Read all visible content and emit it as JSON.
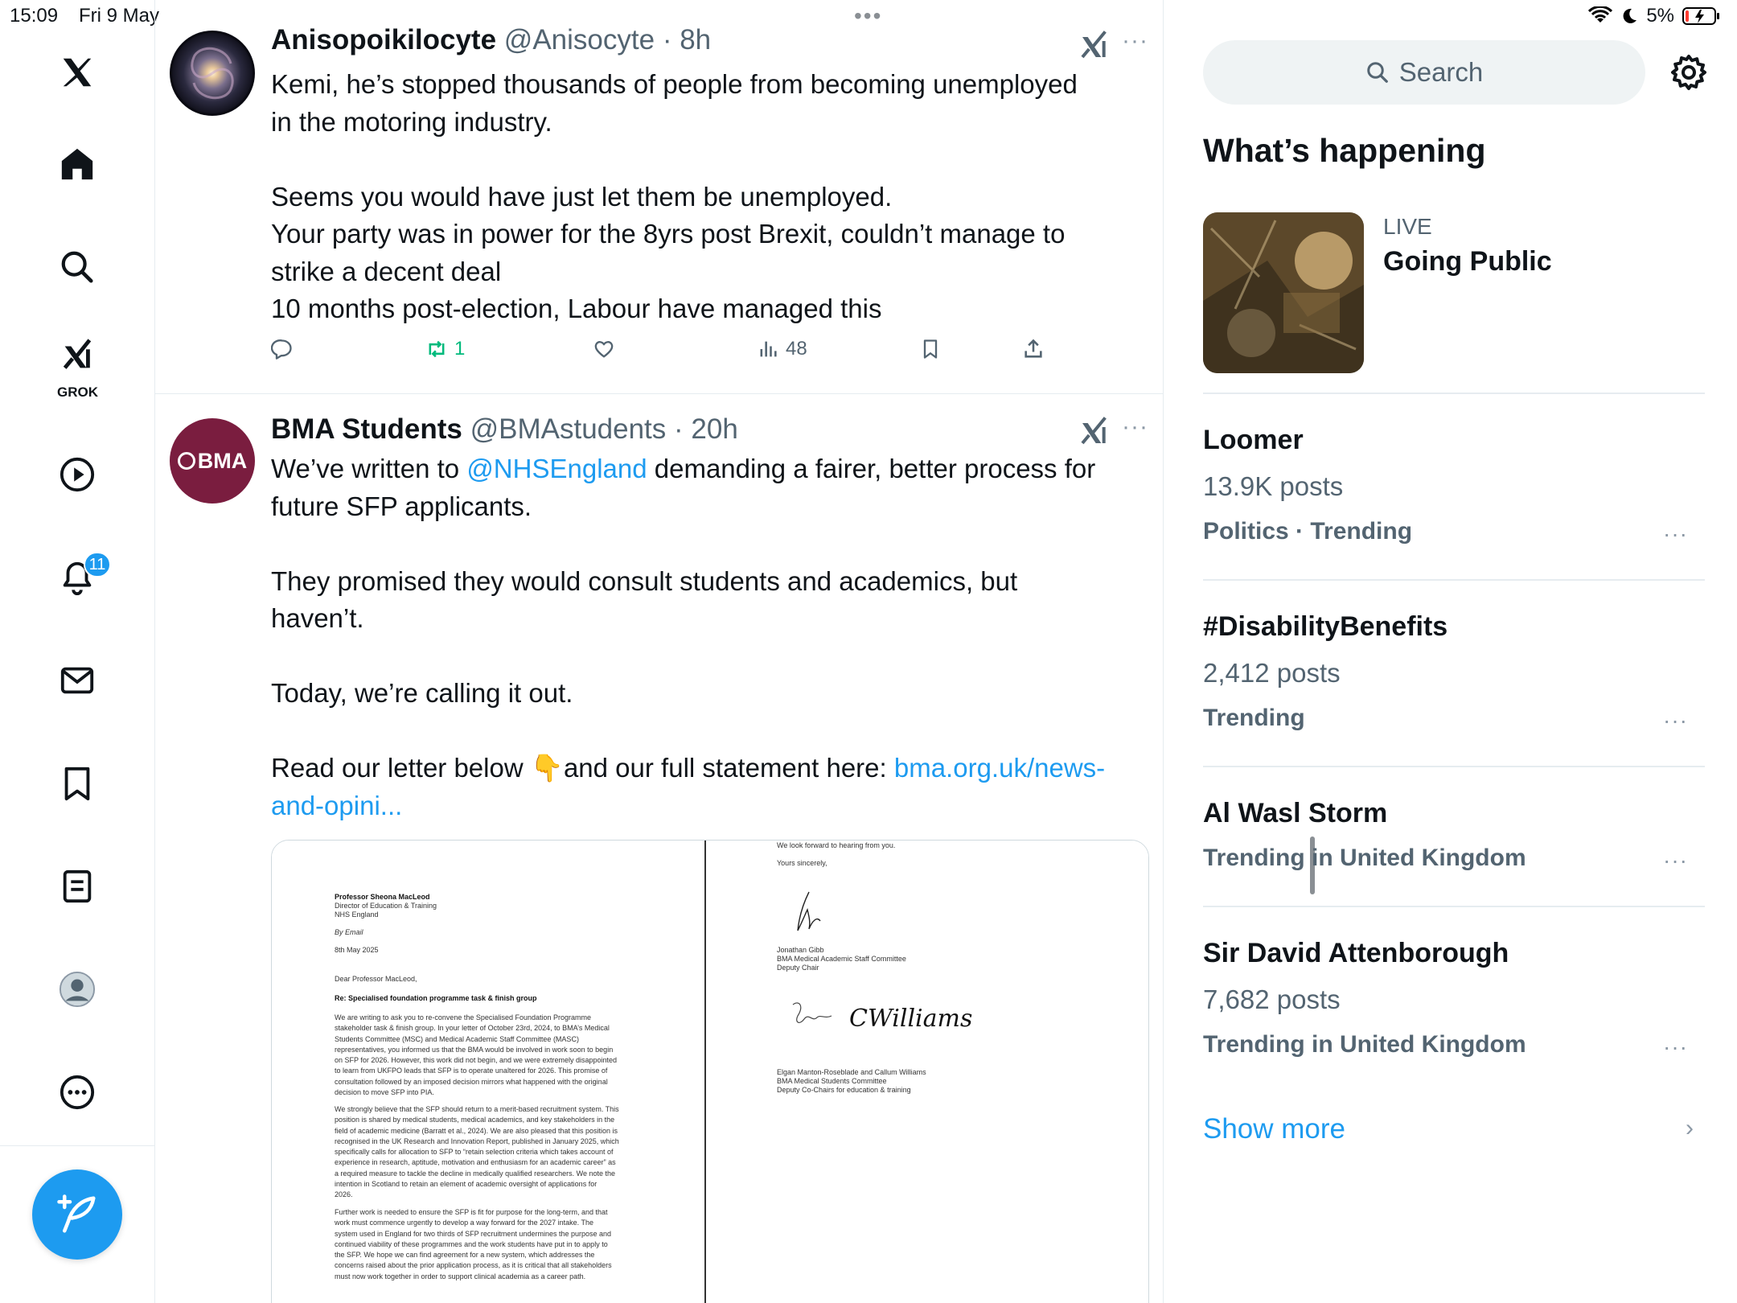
{
  "status_bar": {
    "time": "15:09",
    "date": "Fri 9 May",
    "battery": "5%",
    "multitask_dots": "•••"
  },
  "nav": {
    "grok_label": "GROK",
    "notifications_badge": "11"
  },
  "tweets": [
    {
      "name": "Anisopoikilocyte",
      "handle": "@Anisocyte",
      "sep": "·",
      "time": "8h",
      "more": "···",
      "lines": [
        "Kemi, he’s stopped thousands of people from becoming unemployed",
        "in the motoring industry.",
        "",
        "Seems you would have just let them be unemployed.",
        "Your party was in power for the 8yrs post Brexit, couldn’t manage to",
        "strike a decent deal",
        "10 months post-election, Labour have managed this"
      ],
      "retweets": "1",
      "views": "48"
    },
    {
      "name": "BMA Students",
      "handle": "@BMAstudents",
      "sep": "·",
      "time": "20h",
      "more": "···",
      "avatar_text": "BMA",
      "line1_pre": "We’ve written to ",
      "line1_link": "@NHSEngland",
      "line1_post": " demanding a fairer, better process for",
      "line2": "future SFP applicants.",
      "line3": "They promised they would consult students and academics, but",
      "line4": "haven’t.",
      "line5": "Today, we’re calling it out.",
      "line6_pre": "Read our letter below ",
      "line6_emoji": "👇",
      "line6_post": "and our full statement here: ",
      "line6_link": "bma.org.uk/news-",
      "line7_link": "and-opini..."
    }
  ],
  "letter_left": {
    "recipient": "Professor Sheona MacLeod",
    "recipient_role": "Director of Education & Training",
    "recipient_org": "NHS England",
    "by_email": "By Email",
    "date": "8th May 2025",
    "salutation": "Dear Professor MacLeod,",
    "subject": "Re: Specialised foundation programme task & finish group",
    "para1": "We are writing to ask you to re-convene the Specialised Foundation Programme\nstakeholder task & finish group. In your letter of October 23rd, 2024, to BMA’s Medical\nStudents Committee (MSC) and Medical Academic Staff Committee (MASC)\nrepresentatives, you informed us that the BMA would be involved in work soon to begin\non SFP for 2026. However, this work did not begin, and we were extremely disappointed\nto learn from UKFPO leads that SFP is to operate unaltered for 2026. This promise of\nconsultation followed by an imposed decision mirrors what happened with the original\ndecision to move SFP into PIA.",
    "para2": "We strongly believe that the SFP should return to a merit-based recruitment system. This\nposition is shared by medical students, medical academics, and key stakeholders in the\nfield of academic medicine (Barratt et al., 2024). We are also pleased that this position is\nrecognised in the UK Research and Innovation Report, published in January 2025, which\nspecifically calls for allocation to SFP to “retain selection criteria which takes account of\nexperience in research, aptitude, motivation and enthusiasm for an academic career” as\na required measure to tackle the decline in medically qualified researchers. We note the\nintention in Scotland to retain an element of academic oversight of applications for\n2026.",
    "para3": "Further work is needed to ensure the SFP is fit for purpose for the long-term, and that\nwork must commence urgently to develop a way forward for the 2027 intake. The\nsystem used in England for two thirds of SFP recruitment undermines the purpose and\ncontinued viability of these programmes and the work students have put in to apply to\nthe SFP. We hope we can find agreement for a new system, which addresses the\nconcerns raised about the prior application process, as it is critical that all stakeholders\nmust now work together in order to support clinical academia as a career path."
  },
  "letter_right": {
    "closing1": "We look forward to hearing from you.",
    "closing2": "Yours sincerely,",
    "signer1": "Jonathan Gibb",
    "signer1_role": "BMA Medical Academic Staff Committee",
    "signer1_title": "Deputy Chair",
    "signature2_text": "CWilliams",
    "signers2": "Elgan Manton-Roseblade and Callum Williams",
    "signers2_role": "BMA Medical Students Committee",
    "signers2_title": "Deputy Co-Chairs for education & training"
  },
  "sidebar": {
    "search_placeholder": "Search",
    "section_title": "What’s happening",
    "live": {
      "label": "LIVE",
      "title": "Going Public"
    },
    "trends": [
      {
        "title": "Loomer",
        "posts": "13.9K posts",
        "category": "Politics · Trending"
      },
      {
        "title": "#DisabilityBenefits",
        "posts": "2,412 posts",
        "category": "Trending"
      },
      {
        "title": "Al Wasl Storm",
        "posts": "",
        "category": "Trending in United Kingdom"
      },
      {
        "title": "Sir David Attenborough",
        "posts": "7,682 posts",
        "category": "Trending in United Kingdom"
      }
    ],
    "trend_more": "···",
    "show_more": "Show more",
    "show_more_chevron": "›"
  },
  "colors": {
    "accent": "#1d9bf0",
    "retweet_green": "#00ba7c",
    "muted": "#536471",
    "bma_maroon": "#7a1d3f"
  },
  "icons": [
    "x-logo-icon",
    "home-icon",
    "search-icon",
    "grok-icon",
    "video-icon",
    "bell-icon",
    "mail-icon",
    "bookmark-icon",
    "lists-icon",
    "profile-icon",
    "more-circle-icon",
    "compose-icon",
    "grok-analyze-icon",
    "reply-icon",
    "retweet-icon",
    "like-icon",
    "views-icon",
    "share-icon",
    "settings-gear-icon",
    "wifi-icon",
    "moon-icon",
    "battery-icon"
  ]
}
